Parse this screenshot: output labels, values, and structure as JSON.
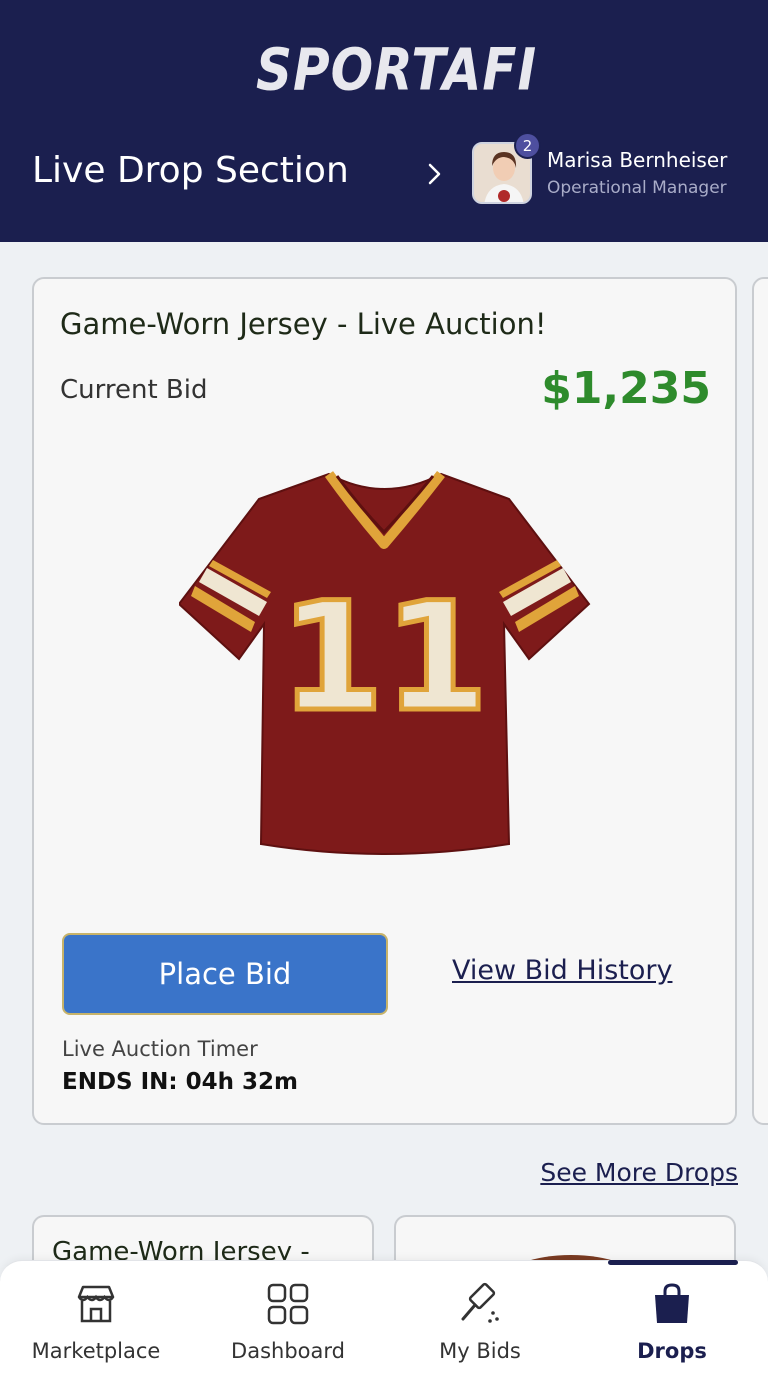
{
  "header": {
    "brand": "SPORTAFI",
    "section_title": "Live Drop Section",
    "notification_count": "2",
    "user": {
      "name": "Marisa Bernheiser",
      "role": "Operational Manager"
    }
  },
  "featured": {
    "title": "Game-Worn Jersey - Live Auction!",
    "current_bid_label": "Current Bid",
    "current_bid_value": "$1,235",
    "jersey_number": "11",
    "place_bid_label": "Place Bid",
    "history_link": "View Bid History",
    "timer_label": "Live Auction Timer",
    "timer_value": "ENDS IN: 04h 32m"
  },
  "see_more_label": "See More Drops",
  "more_drops": [
    {
      "title": "Game-Worn Jersey -"
    }
  ],
  "nav": {
    "items": [
      {
        "label": "Marketplace",
        "icon": "storefront-icon"
      },
      {
        "label": "Dashboard",
        "icon": "grid-icon"
      },
      {
        "label": "My Bids",
        "icon": "gavel-icon"
      },
      {
        "label": "Drops",
        "icon": "shopping-bag-icon"
      }
    ],
    "active": "Drops"
  },
  "colors": {
    "header_bg": "#1b1f4f",
    "bid_green": "#2e8b2c",
    "button_blue": "#3a74c9",
    "jersey_red": "#7e1a1a",
    "jersey_gold": "#e0a43a"
  }
}
